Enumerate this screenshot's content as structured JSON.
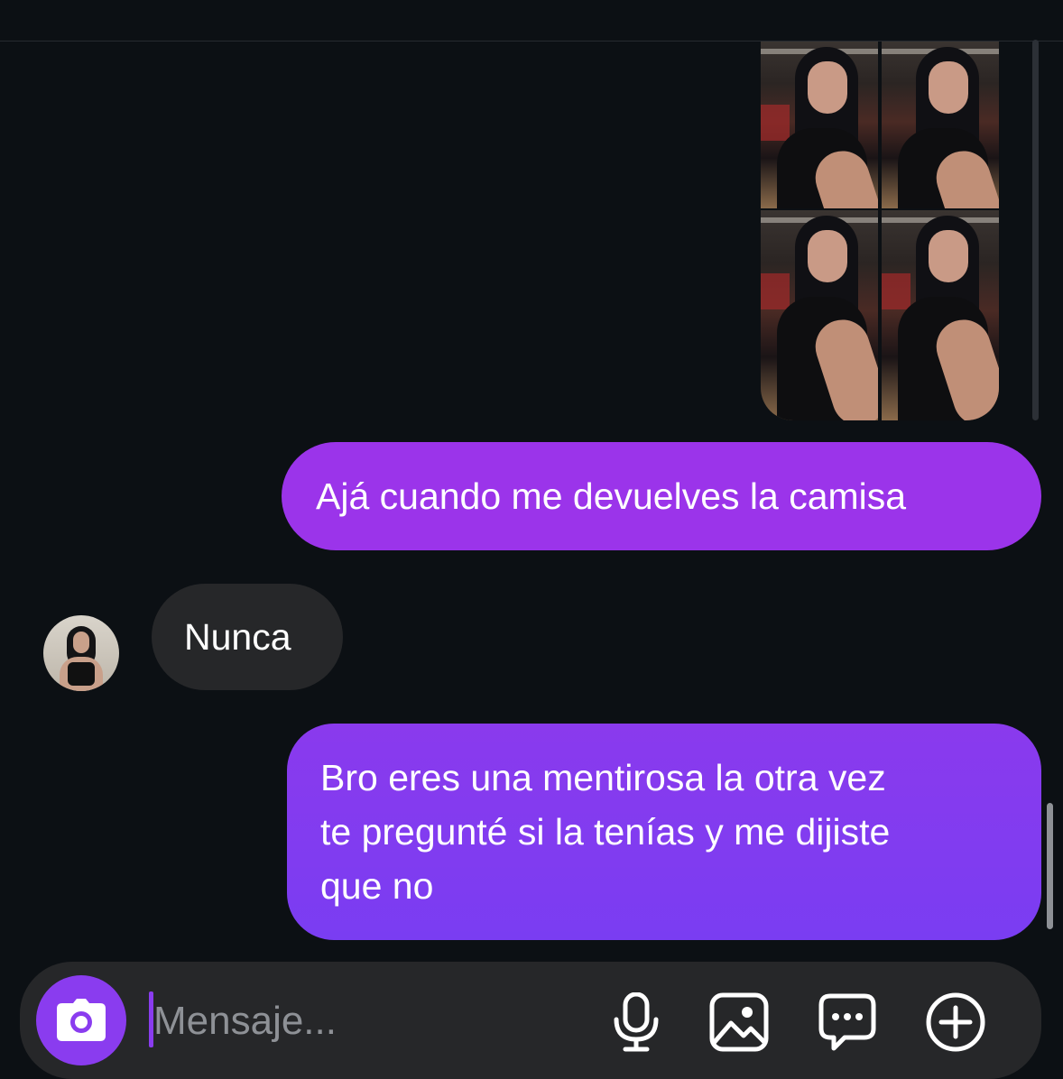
{
  "messages": [
    {
      "type": "sent",
      "text": "Ajá cuando me devuelves la camisa"
    },
    {
      "type": "received",
      "text": "Nunca"
    },
    {
      "type": "sent",
      "lines": [
        "Bro eres una mentirosa la otra vez",
        "te pregunté si la tenías y me dijiste",
        "que no"
      ]
    }
  ],
  "photo_grid": {
    "count": 4
  },
  "composer": {
    "placeholder": "Mensaje..."
  },
  "icons": {
    "camera": "camera-icon",
    "microphone": "microphone-icon",
    "gallery": "image-icon",
    "quick_reply": "chat-bubble-dots-icon",
    "add": "plus-circle-icon"
  },
  "colors": {
    "background": "#0c1014",
    "sent_bubble": "#9b34ea",
    "sent_bubble_2": "#7a3df2",
    "received_bubble": "#262729",
    "accent": "#8a3cef"
  }
}
